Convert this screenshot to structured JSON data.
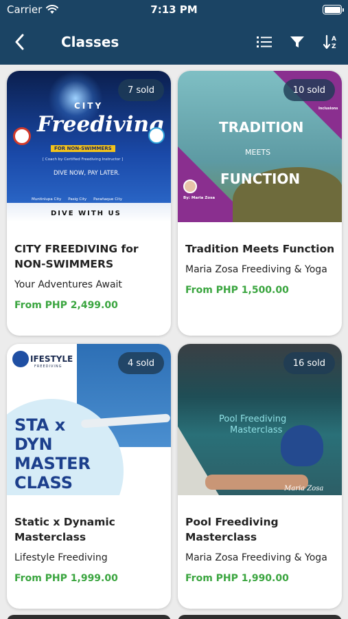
{
  "status_bar": {
    "carrier": "Carrier",
    "time": "7:13 PM"
  },
  "header": {
    "title": "Classes"
  },
  "colors": {
    "header": "#1b4464",
    "price": "#3aa53f"
  },
  "icons": [
    "wifi-icon",
    "battery-icon",
    "back-chevron-icon",
    "list-icon",
    "filter-icon",
    "sort-icon"
  ],
  "cards": [
    {
      "sold": "7 sold",
      "title": "CITY FREEDIVING for NON-SWIMMERS",
      "vendor": "Your Adventures Await",
      "price": "From PHP 2,499.00",
      "poster": {
        "city": "CITY",
        "headline": "Freediving",
        "ribbon": "FOR NON-SWIMMERS",
        "coach": "[ Coach by Certified Freediving Instructor ]",
        "slogan": "DIVE NOW, PAY LATER.",
        "locations": [
          "Muntinlupa City",
          "Pasig City",
          "Parañaque City"
        ],
        "footer": "DIVE WITH US"
      }
    },
    {
      "sold": "10 sold",
      "title": "Tradition Meets Function",
      "vendor": "Maria Zosa Freediving & Yoga",
      "price": "From PHP 1,500.00",
      "poster": {
        "line1": "TRADITION",
        "line2": "MEETS",
        "line3": "FUNCTION",
        "by": "By: Maria Zosa",
        "inclusions": "Inclusions"
      }
    },
    {
      "sold": "4 sold",
      "title": "Static x Dynamic Masterclass",
      "vendor": "Lifestyle Freediving",
      "price": "From PHP 1,999.00",
      "poster": {
        "logo": "IFESTYLE",
        "logo_sub": "FREEDIVING",
        "lines": [
          "STA x",
          "DYN",
          "MASTER",
          "CLASS"
        ]
      }
    },
    {
      "sold": "16 sold",
      "title": "Pool Freediving Masterclass",
      "vendor": "Maria Zosa Freediving & Yoga",
      "price": "From PHP 1,990.00",
      "poster": {
        "line1": "Pool Freediving",
        "line2": "Masterclass",
        "signature": "Maria Zosa"
      }
    }
  ]
}
